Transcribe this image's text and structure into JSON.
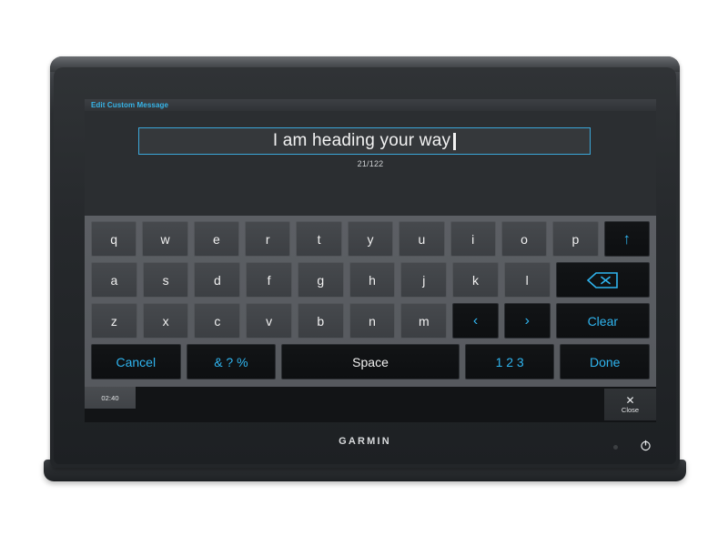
{
  "device": {
    "brand": "GARMIN",
    "power_icon": "power-icon",
    "sensor": "ambient-light-sensor"
  },
  "screen": {
    "titlebar": {
      "label": "Edit Custom Message",
      "color": "#36b4e8"
    },
    "compose": {
      "input_value": "I am heading your way",
      "char_count": "21/122",
      "border_color": "#3ba6d8"
    },
    "keyboard": {
      "rows": [
        [
          {
            "label": "q",
            "type": "letter",
            "name": "key-q"
          },
          {
            "label": "w",
            "type": "letter",
            "name": "key-w"
          },
          {
            "label": "e",
            "type": "letter",
            "name": "key-e"
          },
          {
            "label": "r",
            "type": "letter",
            "name": "key-r"
          },
          {
            "label": "t",
            "type": "letter",
            "name": "key-t"
          },
          {
            "label": "y",
            "type": "letter",
            "name": "key-y"
          },
          {
            "label": "u",
            "type": "letter",
            "name": "key-u"
          },
          {
            "label": "i",
            "type": "letter",
            "name": "key-i"
          },
          {
            "label": "o",
            "type": "letter",
            "name": "key-o"
          },
          {
            "label": "p",
            "type": "letter",
            "name": "key-p"
          },
          {
            "label": "↑",
            "type": "func",
            "name": "key-shift",
            "icon": "arrow-up-icon"
          }
        ],
        [
          {
            "label": "a",
            "type": "letter",
            "name": "key-a"
          },
          {
            "label": "s",
            "type": "letter",
            "name": "key-s"
          },
          {
            "label": "d",
            "type": "letter",
            "name": "key-d"
          },
          {
            "label": "f",
            "type": "letter",
            "name": "key-f"
          },
          {
            "label": "g",
            "type": "letter",
            "name": "key-g"
          },
          {
            "label": "h",
            "type": "letter",
            "name": "key-h"
          },
          {
            "label": "j",
            "type": "letter",
            "name": "key-j"
          },
          {
            "label": "k",
            "type": "letter",
            "name": "key-k"
          },
          {
            "label": "l",
            "type": "letter",
            "name": "key-l"
          },
          {
            "label": "",
            "type": "func",
            "name": "key-backspace",
            "icon": "backspace-icon"
          }
        ],
        [
          {
            "label": "z",
            "type": "letter",
            "name": "key-z"
          },
          {
            "label": "x",
            "type": "letter",
            "name": "key-x"
          },
          {
            "label": "c",
            "type": "letter",
            "name": "key-c"
          },
          {
            "label": "v",
            "type": "letter",
            "name": "key-v"
          },
          {
            "label": "b",
            "type": "letter",
            "name": "key-b"
          },
          {
            "label": "n",
            "type": "letter",
            "name": "key-n"
          },
          {
            "label": "m",
            "type": "letter",
            "name": "key-m"
          },
          {
            "label": "‹",
            "type": "func",
            "name": "key-cursor-left",
            "icon": "chevron-left-icon"
          },
          {
            "label": "›",
            "type": "func",
            "name": "key-cursor-right",
            "icon": "chevron-right-icon"
          },
          {
            "label": "Clear",
            "type": "func",
            "name": "key-clear"
          }
        ],
        [
          {
            "label": "Cancel",
            "type": "func",
            "name": "key-cancel"
          },
          {
            "label": "& ? %",
            "type": "func",
            "name": "key-symbols"
          },
          {
            "label": "Space",
            "type": "func-white",
            "name": "key-space"
          },
          {
            "label": "1 2 3",
            "type": "func",
            "name": "key-numbers"
          },
          {
            "label": "Done",
            "type": "func",
            "name": "key-done"
          }
        ]
      ]
    },
    "statusbar": {
      "clock": "02:40",
      "close_label": "Close",
      "close_icon": "close-x-icon"
    }
  }
}
